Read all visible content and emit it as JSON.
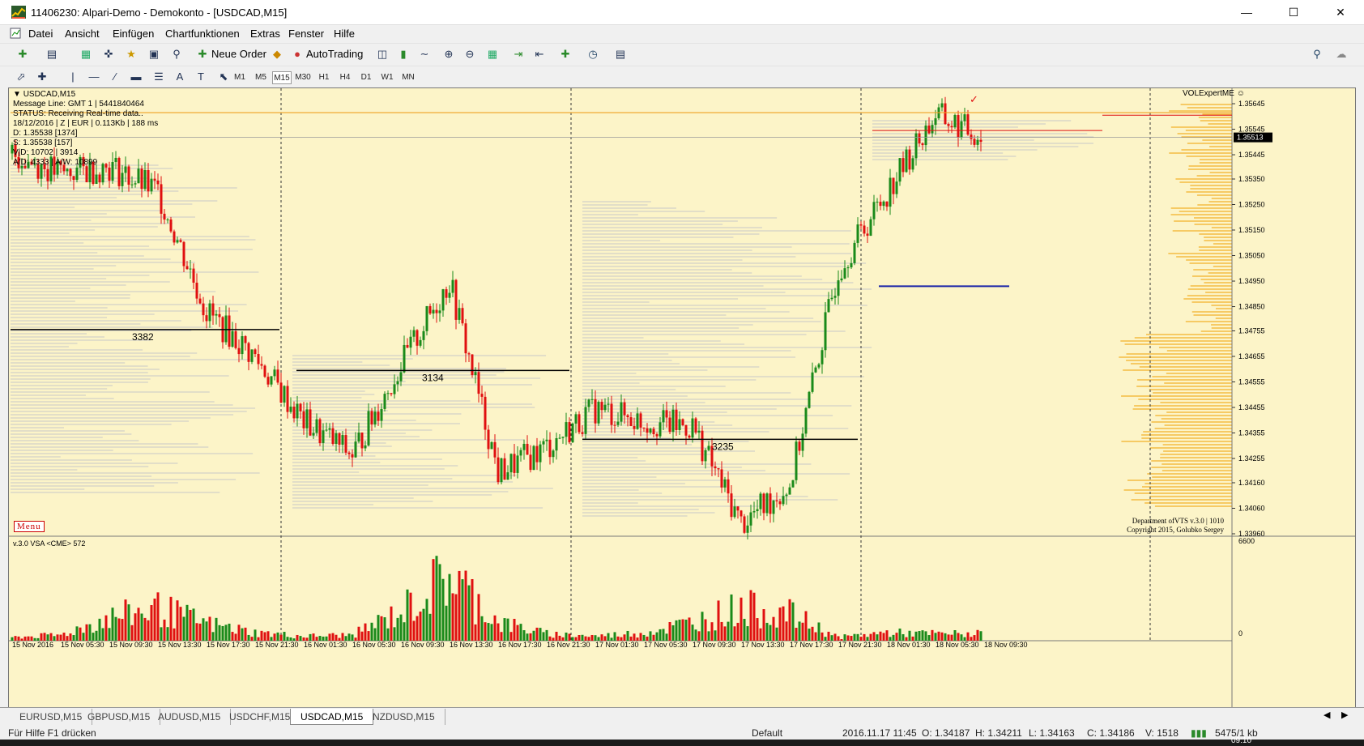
{
  "window": {
    "title": "11406230: Alpari-Demo - Demokonto - [USDCAD,M15]"
  },
  "menu": [
    "Datei",
    "Ansicht",
    "Einfügen",
    "Chartfunktionen",
    "Extras",
    "Fenster",
    "Hilfe"
  ],
  "toolbar": {
    "new_order": "Neue Order",
    "autotrading": "AutoTrading"
  },
  "timeframes": [
    "M1",
    "M5",
    "M15",
    "M30",
    "H1",
    "H4",
    "D1",
    "W1",
    "MN"
  ],
  "active_timeframe": "M15",
  "chart": {
    "symbol_label": "USDCAD,M15",
    "info_lines": [
      "Message Line: GMT 1 | 5441840464",
      "STATUS:  Receiving Real-time data..",
      "18/12/2016 | Z | EUR | 0.113Kb | 188 ms",
      "D: 1.35538  [1374]",
      "S: 1.35538  [157]",
      "V|D: 10702 | 3914",
      "A/D: 4333 | A/W: 10899"
    ],
    "expert_label": "VOLExpertME",
    "menu_button": "Menu",
    "copyright_1": "Department ofVTS  v.3.0 | 1010",
    "copyright_2": "Copyright 2015, Golubko Sergey",
    "current_price": "1.35513",
    "price_ticks": [
      "1.35645",
      "1.35545",
      "1.35445",
      "1.35350",
      "1.35250",
      "1.35150",
      "1.35050",
      "1.34950",
      "1.34850",
      "1.34755",
      "1.34655",
      "1.34555",
      "1.34455",
      "1.34355",
      "1.34255",
      "1.34160",
      "1.34060",
      "1.33960"
    ],
    "level_labels": [
      "3382",
      "3134",
      "3235"
    ],
    "volume_label": "v.3.0 VSA <CME> 572",
    "volume_ticks": [
      "6600",
      "0"
    ],
    "time_labels": [
      "15 Nov 2016",
      "15 Nov 05:30",
      "15 Nov 09:30",
      "15 Nov 13:30",
      "15 Nov 17:30",
      "15 Nov 21:30",
      "16 Nov 01:30",
      "16 Nov 05:30",
      "16 Nov 09:30",
      "16 Nov 13:30",
      "16 Nov 17:30",
      "16 Nov 21:30",
      "17 Nov 01:30",
      "17 Nov 05:30",
      "17 Nov 09:30",
      "17 Nov 13:30",
      "17 Nov 17:30",
      "17 Nov 21:30",
      "18 Nov 01:30",
      "18 Nov 05:30",
      "18 Nov 09:30"
    ]
  },
  "chart_data": {
    "type": "line",
    "title": "USDCAD,M15",
    "ylim": [
      1.3396,
      1.3568
    ],
    "x": [
      "15 Nov 2016",
      "15 Nov 05:30",
      "15 Nov 09:30",
      "15 Nov 13:30",
      "15 Nov 17:30",
      "15 Nov 21:30",
      "16 Nov 01:30",
      "16 Nov 05:30",
      "16 Nov 09:30",
      "16 Nov 13:30",
      "16 Nov 17:30",
      "16 Nov 21:30",
      "17 Nov 01:30",
      "17 Nov 05:30",
      "17 Nov 09:30",
      "17 Nov 13:30",
      "17 Nov 17:30",
      "17 Nov 21:30",
      "18 Nov 01:30",
      "18 Nov 05:30",
      "18 Nov 09:30"
    ],
    "series": [
      {
        "values": [
          1.3545,
          1.3537,
          1.354,
          1.353,
          1.3483,
          1.3465,
          1.344,
          1.3427,
          1.3462,
          1.3495,
          1.342,
          1.343,
          1.3445,
          1.344,
          1.3438,
          1.34,
          1.3415,
          1.35,
          1.353,
          1.356,
          1.3551
        ]
      }
    ],
    "volume": {
      "ylim": [
        0,
        6600
      ],
      "values": [
        300,
        500,
        2000,
        2800,
        1500,
        700,
        400,
        500,
        2500,
        5800,
        1600,
        600,
        400,
        700,
        1600,
        2900,
        2300,
        300,
        700,
        600,
        600
      ]
    }
  },
  "tabs": [
    "EURUSD,M15",
    "GBPUSD,M15",
    "AUDUSD,M15",
    "USDCHF,M15",
    "USDCAD,M15",
    "NZDUSD,M15"
  ],
  "active_tab": "USDCAD,M15",
  "status": {
    "help": "Für Hilfe F1 drücken",
    "profile": "Default",
    "datetime": "2016.11.17 11:45",
    "open": "O: 1.34187",
    "high": "H: 1.34211",
    "low": "L: 1.34163",
    "close": "C: 1.34186",
    "volume": "V: 1518",
    "traffic": "5475/1 kb"
  },
  "taskbar": {
    "clock": "09:10"
  },
  "colors": {
    "chart_bg": "#fcf4c8",
    "bull": "#1a8a1a",
    "bear": "#e01010",
    "level_line": "#000000",
    "profile_right": "#f0a000",
    "profile_left": "#c8c8c8",
    "orange_line": "#f0a020"
  }
}
